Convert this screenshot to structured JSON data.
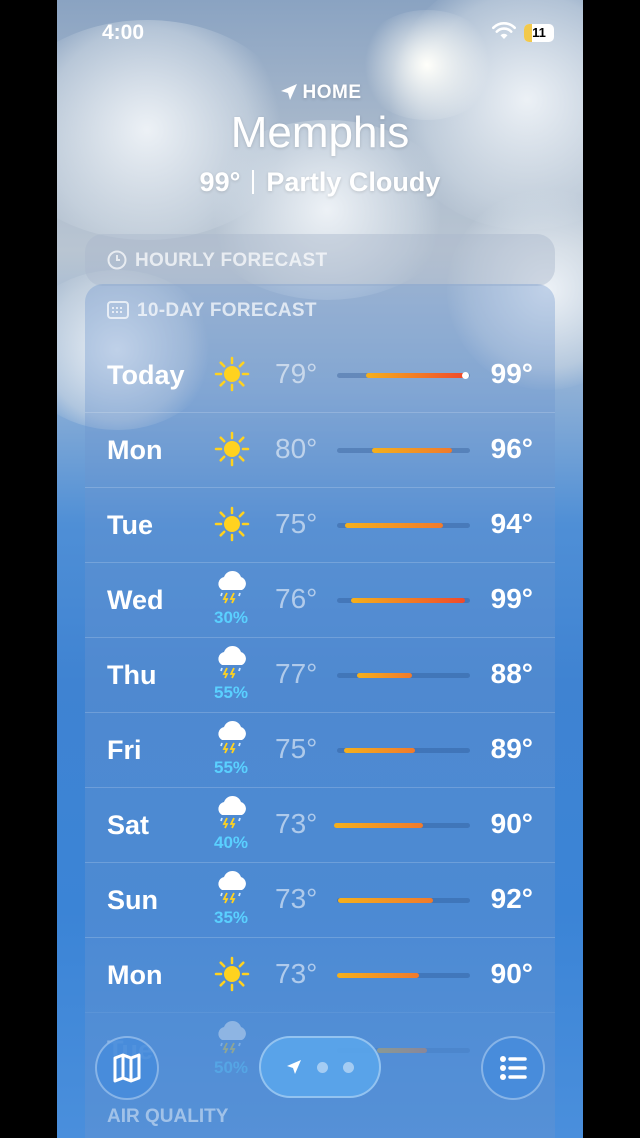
{
  "status": {
    "time": "4:00",
    "battery": "11"
  },
  "location": {
    "label": "HOME",
    "city": "Memphis",
    "temperature": "99°",
    "condition": "Partly Cloudy"
  },
  "hourly": {
    "title": "HOURLY FORECAST"
  },
  "forecast": {
    "title": "10-DAY FORECAST",
    "days": [
      {
        "day": "Today",
        "icon": "sun-icon",
        "precip": "",
        "low": "79°",
        "high": "99°"
      },
      {
        "day": "Mon",
        "icon": "sun-icon",
        "precip": "",
        "low": "80°",
        "high": "96°"
      },
      {
        "day": "Tue",
        "icon": "sun-icon",
        "precip": "",
        "low": "75°",
        "high": "94°"
      },
      {
        "day": "Wed",
        "icon": "thunderstorm-icon",
        "precip": "30%",
        "low": "76°",
        "high": "99°"
      },
      {
        "day": "Thu",
        "icon": "thunderstorm-icon",
        "precip": "55%",
        "low": "77°",
        "high": "88°"
      },
      {
        "day": "Fri",
        "icon": "thunderstorm-icon",
        "precip": "55%",
        "low": "75°",
        "high": "89°"
      },
      {
        "day": "Sat",
        "icon": "thunderstorm-icon",
        "precip": "40%",
        "low": "73°",
        "high": "90°"
      },
      {
        "day": "Sun",
        "icon": "thunderstorm-icon",
        "precip": "35%",
        "low": "73°",
        "high": "92°"
      },
      {
        "day": "Mon",
        "icon": "sun-icon",
        "precip": "",
        "low": "73°",
        "high": "90°"
      },
      {
        "day": "Tue",
        "icon": "thunderstorm-icon",
        "precip": "50%",
        "low": "",
        "high": ""
      }
    ]
  },
  "air_quality": {
    "title": "AIR QUALITY"
  },
  "colors": {
    "accent": "#5ad0ff",
    "bar_cool": "#f5b01c",
    "bar_hot": "#f04a2c"
  }
}
